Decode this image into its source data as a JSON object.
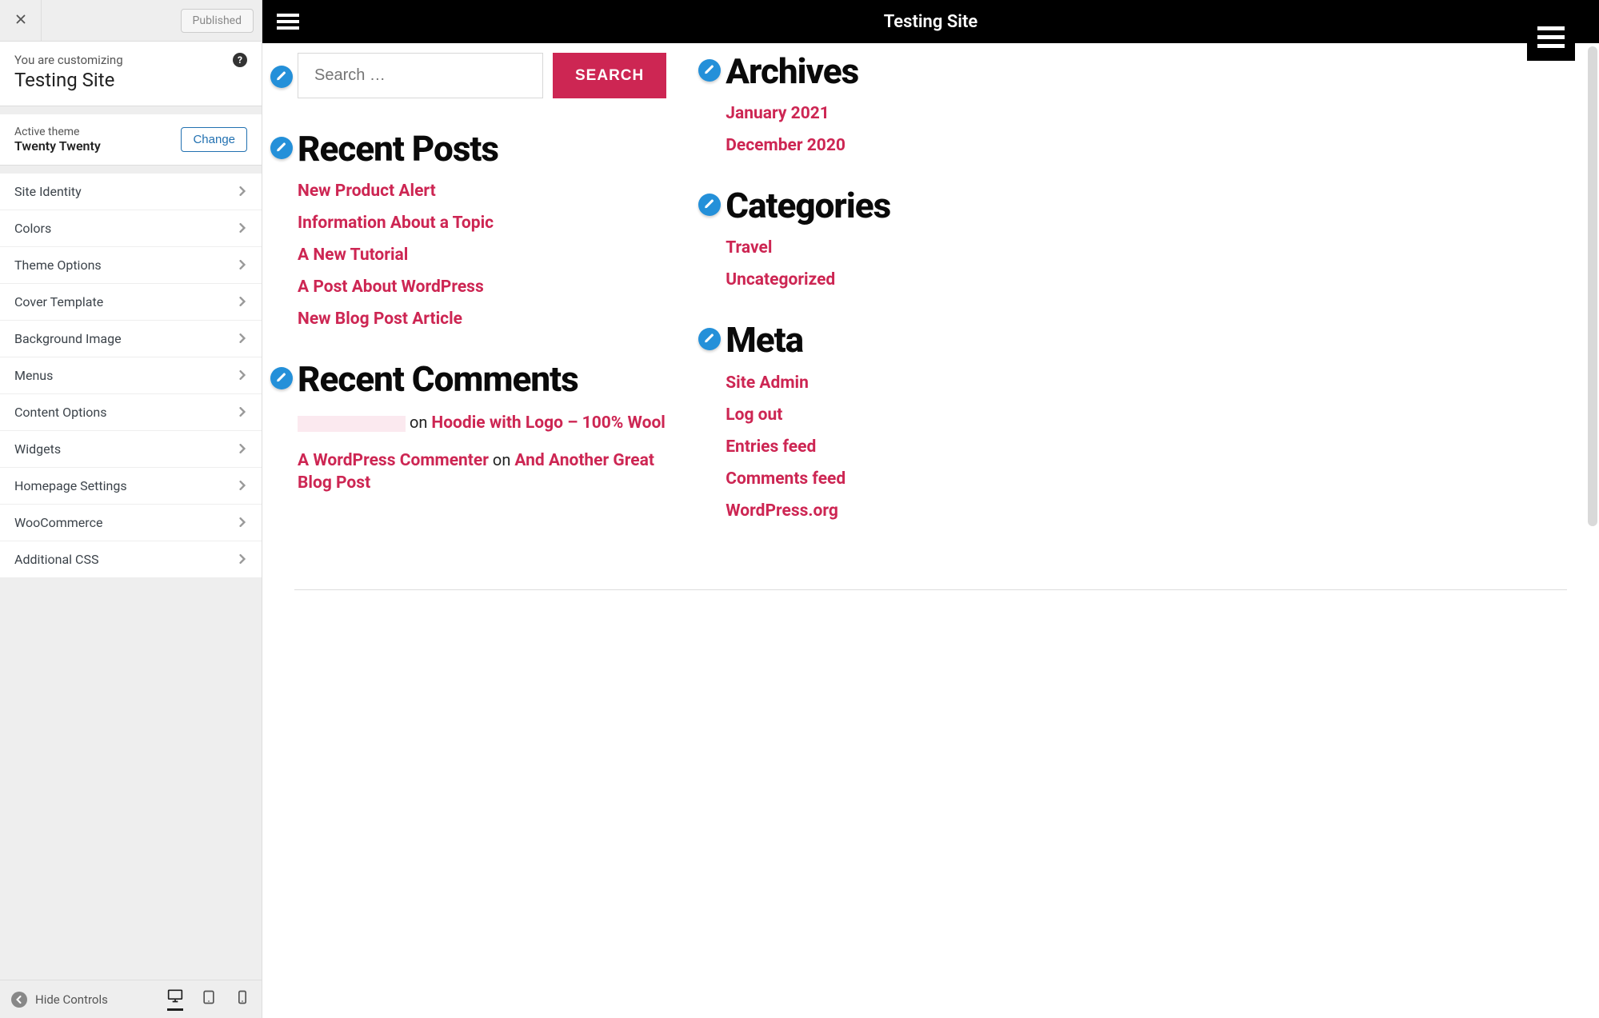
{
  "customizer": {
    "status_label": "Published",
    "intro_label": "You are customizing",
    "site_name": "Testing Site",
    "active_theme_label": "Active theme",
    "active_theme_name": "Twenty Twenty",
    "change_label": "Change",
    "panels": [
      "Site Identity",
      "Colors",
      "Theme Options",
      "Cover Template",
      "Background Image",
      "Menus",
      "Content Options",
      "Widgets",
      "Homepage Settings",
      "WooCommerce",
      "Additional CSS"
    ],
    "hide_controls_label": "Hide Controls"
  },
  "preview": {
    "site_title": "Testing Site",
    "search": {
      "placeholder": "Search …",
      "button": "SEARCH"
    },
    "recent_posts": {
      "title": "Recent Posts",
      "items": [
        "New Product Alert",
        "Information About a Topic",
        "A New Tutorial",
        "A Post About WordPress",
        "New Blog Post Article"
      ]
    },
    "recent_comments": {
      "title": "Recent Comments",
      "items": [
        {
          "author": "",
          "redacted": true,
          "on": " on ",
          "post": "Hoodie with Logo – 100% Wool"
        },
        {
          "author": "A WordPress Commenter",
          "redacted": false,
          "on": " on ",
          "post": "And Another Great Blog Post"
        }
      ]
    },
    "archives": {
      "title": "Archives",
      "items": [
        "January 2021",
        "December 2020"
      ]
    },
    "categories": {
      "title": "Categories",
      "items": [
        "Travel",
        "Uncategorized"
      ]
    },
    "meta": {
      "title": "Meta",
      "items": [
        "Site Admin",
        "Log out",
        "Entries feed",
        "Comments feed",
        "WordPress.org"
      ]
    }
  }
}
